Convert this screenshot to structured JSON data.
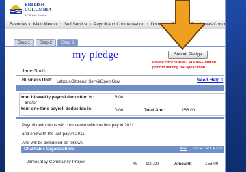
{
  "brand": {
    "line1": "BRITISH",
    "line2": "COLUMBIA",
    "sub": "BC Public Service"
  },
  "nav": {
    "items": [
      "Favorites",
      "Main Menu",
      "Self Service",
      "Payroll and Compensation",
      "Donate",
      "Provincial Employees Community Fund"
    ]
  },
  "tabs": [
    "Step 1",
    "Step 2",
    "Step 3"
  ],
  "page": {
    "title": "my pledge",
    "submit_label": "Submit Pledge",
    "submit_note": "Please click SUBMIT PLEDGE button prior to leaving the application.",
    "employee_name": "Jane Smith",
    "business_unit_label": "Business Unit:",
    "business_unit_value": "Labour,Citizens' Serv&Open Gov",
    "help_link": "Need Help ?"
  },
  "deductions": {
    "biweekly_label": "Your bi-weekly payroll deduction is:",
    "andor": "and/or",
    "biweekly_value": "6.00",
    "onetime_label": "Your one-time payroll deduction is:",
    "onetime_value": "0.00",
    "total_label": "Total Amt:",
    "total_value": "156.00"
  },
  "info": {
    "line1": "Payroll deductions will commence with the first pay in 2011",
    "line2": "and end with the last pay in 2011",
    "line3": "And will be disbursed as follows:"
  },
  "charities": {
    "title": "Charitable Organizations",
    "find": "Find",
    "first": "First",
    "count": "1 of 1",
    "last": "Last",
    "rows": [
      {
        "name": "James Bay Community Project",
        "pct_symbol": "%",
        "pct": "100.00",
        "amount_label": "Amount:",
        "amount": "156.00"
      }
    ]
  },
  "colors": {
    "background": "#1a3a8c",
    "tab_active": "#7f98c8",
    "title_blue": "#1f1fd0",
    "warning_red": "#e01010",
    "arrow_orange": "#f0a020"
  }
}
